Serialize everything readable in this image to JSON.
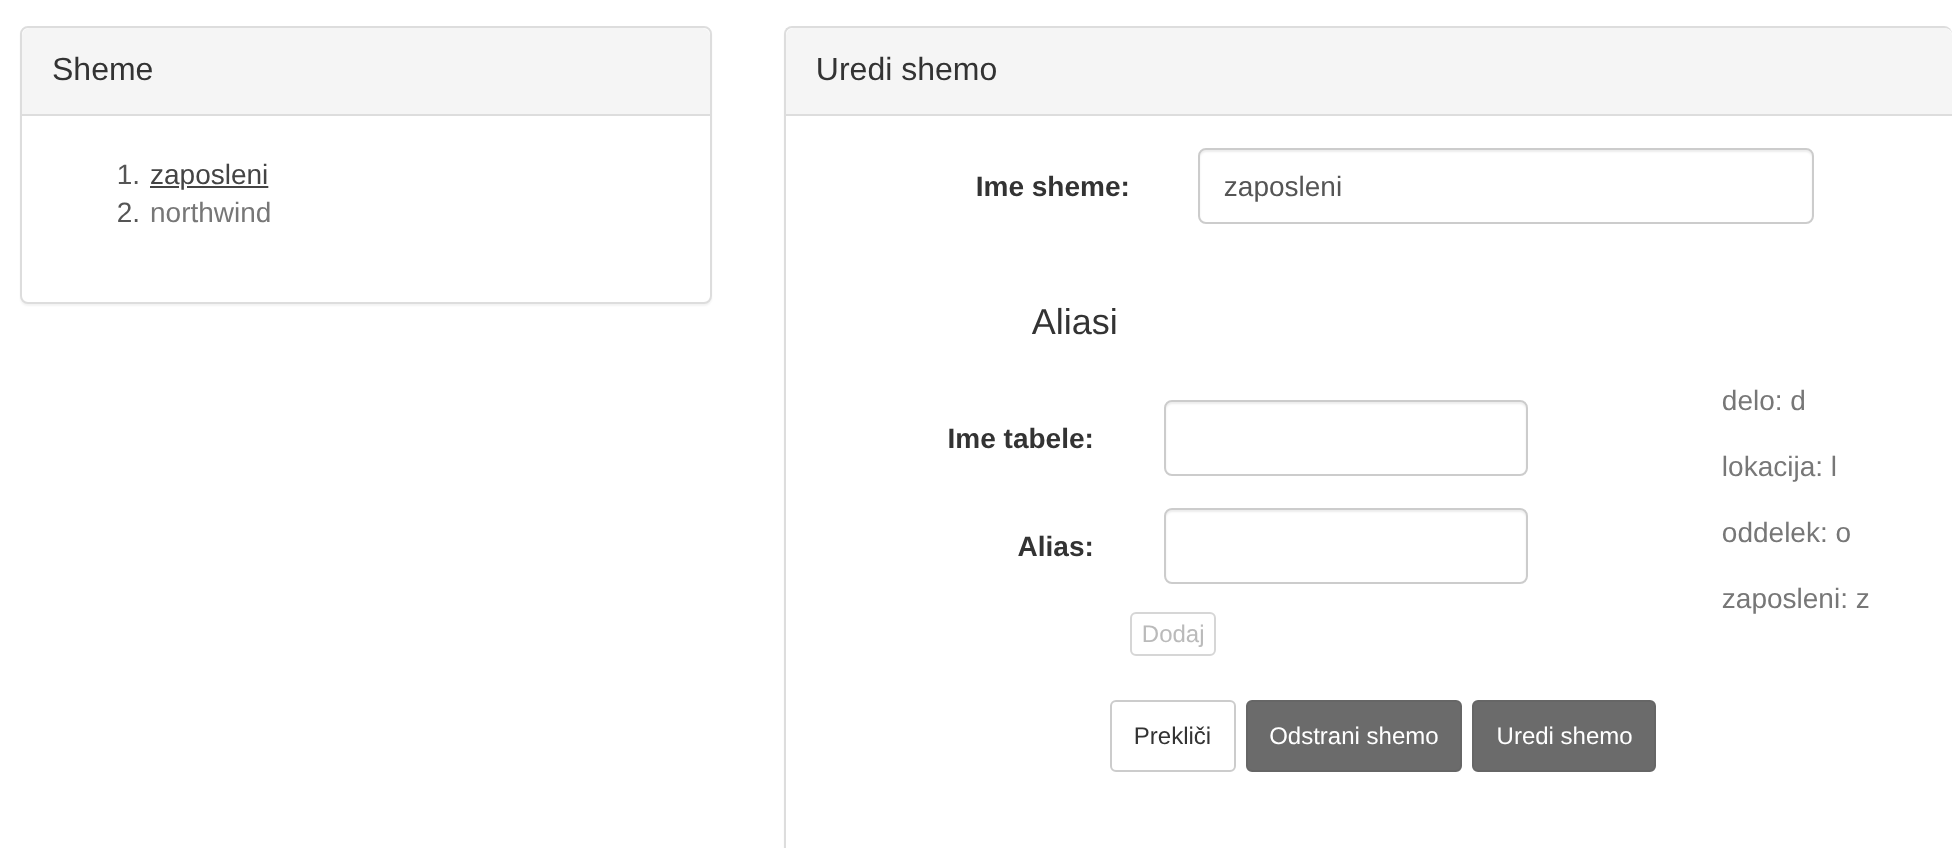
{
  "schemes_panel": {
    "title": "Sheme",
    "items": [
      {
        "marker": "1.",
        "label": "zaposleni",
        "selected": true
      },
      {
        "marker": "2.",
        "label": "northwind",
        "selected": false
      }
    ]
  },
  "edit_panel": {
    "title": "Uredi shemo",
    "scheme_name": {
      "label": "Ime sheme:",
      "value": "zaposleni"
    },
    "aliases_heading": "Aliasi",
    "table_name": {
      "label": "Ime tabele:"
    },
    "alias": {
      "label": "Alias:"
    },
    "add_button": {
      "label": "Dodaj",
      "disabled": true
    },
    "alias_list": [
      "delo: d",
      "lokacija: l",
      "oddelek: o",
      "zaposleni: z"
    ],
    "buttons": [
      {
        "label": "Prekliči",
        "kind": "default"
      },
      {
        "label": "Odstrani shemo",
        "kind": "dark"
      },
      {
        "label": "Uredi shemo",
        "kind": "dark"
      }
    ]
  }
}
